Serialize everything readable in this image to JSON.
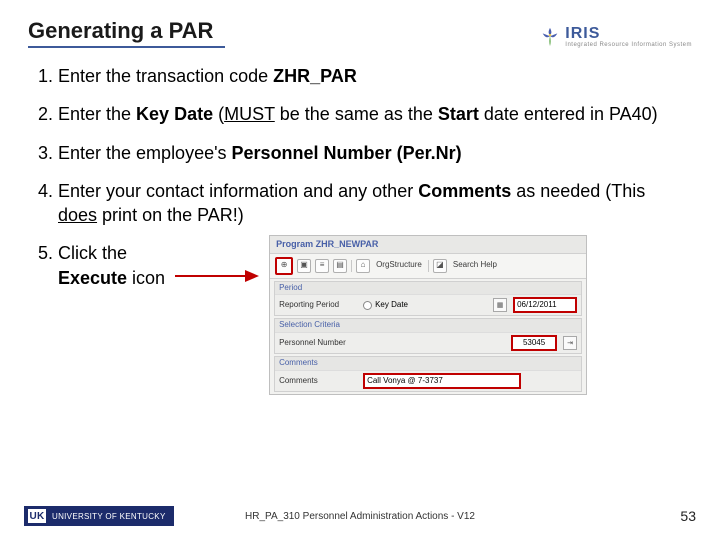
{
  "header": {
    "title": "Generating a PAR",
    "logo": {
      "name": "IRIS",
      "subtitle": "Integrated Resource Information System"
    }
  },
  "steps": {
    "s1_a": "Enter the transaction code ",
    "s1_code": "ZHR_PAR",
    "s2_a": "Enter the ",
    "s2_key": "Key Date",
    "s2_b": " (",
    "s2_must": "MUST",
    "s2_c": " be the same as the ",
    "s2_start": "Start",
    "s2_d": " date entered in PA40)",
    "s3_a": "Enter the employee's ",
    "s3_pn": "Personnel Number (Per.Nr)",
    "s4_a": "Enter your contact information and any other ",
    "s4_com": "Comments",
    "s4_b": " as needed (This ",
    "s4_does": "does",
    "s4_c": " print on the PAR!)",
    "s5_a": "Click the ",
    "s5_exec": "Execute",
    "s5_b": " icon"
  },
  "sap": {
    "title": "Program ZHR_NEWPAR",
    "toolbar": {
      "execute_glyph": "⊕",
      "orgstructure": "OrgStructure",
      "searchhelp": "Search Help"
    },
    "section1": {
      "title": "Period",
      "label": "Reporting Period",
      "radio": "Key Date",
      "date_value": "06/12/2011"
    },
    "section2": {
      "title": "Selection Criteria",
      "label": "Personnel Number",
      "value": "53045"
    },
    "section3": {
      "title": "Comments",
      "label": "Comments",
      "value": "Call Vonya @ 7-3737"
    }
  },
  "footer": {
    "uk_mark": "UK",
    "uk_name": "UNIVERSITY OF KENTUCKY",
    "center": "HR_PA_310 Personnel Administration Actions - V12",
    "page": "53"
  }
}
